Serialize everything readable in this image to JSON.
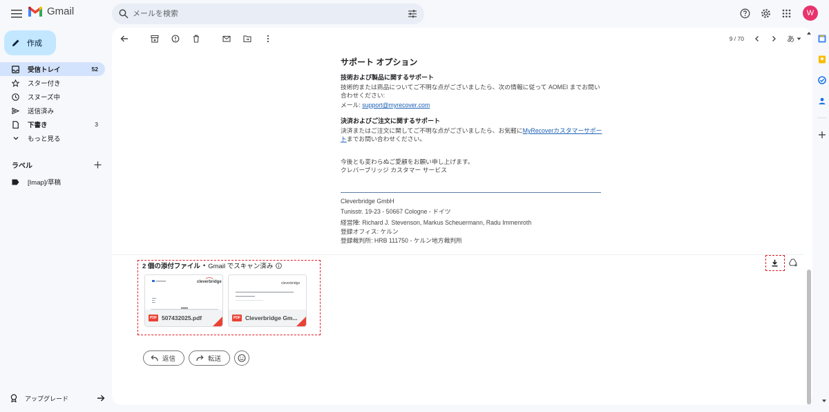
{
  "app": {
    "name": "Gmail"
  },
  "search": {
    "placeholder": "メールを検索"
  },
  "top": {
    "avatar_letter": "W"
  },
  "compose": {
    "label": "作成"
  },
  "nav": {
    "items": [
      {
        "label": "受信トレイ",
        "count": "52",
        "icon": "inbox-icon"
      },
      {
        "label": "スター付き",
        "count": "",
        "icon": "star-icon"
      },
      {
        "label": "スヌーズ中",
        "count": "",
        "icon": "clock-icon"
      },
      {
        "label": "送信済み",
        "count": "",
        "icon": "send-icon"
      },
      {
        "label": "下書き",
        "count": "3",
        "icon": "draft-icon"
      },
      {
        "label": "もっと見る",
        "count": "",
        "icon": "chevron-down-icon"
      }
    ]
  },
  "labels": {
    "title": "ラベル",
    "items": [
      {
        "label": "[Imap]/草稿"
      }
    ]
  },
  "upgrade": {
    "label": "アップグレード"
  },
  "toolbar": {
    "pager": "9 / 70",
    "input_tool": "あ"
  },
  "email": {
    "support_title": "サポート オプション",
    "tech_heading": "技術および製品に関するサポート",
    "tech_body": "技術的または商品についてご不明な点がございましたら、次の情報に従って AOMEI までお問い合わせください:",
    "mail_label": "メール: ",
    "mail_link": "support@myrecover.com",
    "payment_heading": "決済およびご注文に関するサポート",
    "payment_body_pre": "決済またはご注文に関してご不明な点がございましたら、お気軽に",
    "payment_link": "MyRecoverカスタマーサポート",
    "payment_body_post": "までお問い合わせください。",
    "closing_1": "今後とも変わらぬご愛顧をお願い申し上げます。",
    "closing_2": "クレバーブリッジ カスタマー サービス",
    "footer_company": "Cleverbridge GmbH",
    "footer_address": "Tunisstr. 19-23 - 50667 Cologne - ドイツ",
    "footer_managers": "経営陣: Richard J. Stevenson, Markus Scheuermann, Radu Immenroth",
    "footer_office": "登録オフィス: ケルン",
    "footer_court": "登録裁判所: HRB 111750 - ケルン地方裁判所"
  },
  "attachments": {
    "count_label": "2 個の添付ファイル",
    "sep": "•",
    "scan_label": "Gmail でスキャン済み",
    "files": [
      {
        "name": "507432025.pdf",
        "type": "PDF"
      },
      {
        "name": "Cleverbridge Gm...",
        "type": "PDF"
      }
    ]
  },
  "actions": {
    "reply": "返信",
    "forward": "転送"
  },
  "colors": {
    "accent": "#c2e7ff",
    "active_nav": "#d3e3fd",
    "highlight": "#e31b23",
    "pdf": "#e94235"
  }
}
